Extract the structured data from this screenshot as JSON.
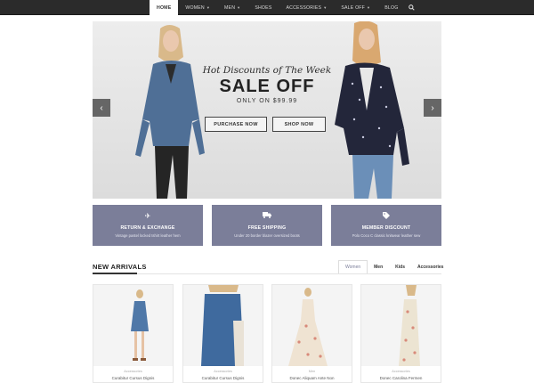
{
  "nav": {
    "items": [
      {
        "label": "HOME",
        "active": true,
        "dropdown": false
      },
      {
        "label": "WOMEN",
        "active": false,
        "dropdown": true
      },
      {
        "label": "MEN",
        "active": false,
        "dropdown": true
      },
      {
        "label": "SHOES",
        "active": false,
        "dropdown": false
      },
      {
        "label": "ACCESSORIES",
        "active": false,
        "dropdown": true
      },
      {
        "label": "SALE OFF",
        "active": false,
        "dropdown": true
      },
      {
        "label": "BLOG",
        "active": false,
        "dropdown": false
      }
    ],
    "search_icon": "search-icon"
  },
  "hero": {
    "tagline": "Hot Discounts of The Week",
    "title": "SALE OFF",
    "subtitle": "ONLY ON $99.99",
    "primary_button": "PURCHASE NOW",
    "secondary_button": "SHOP NOW",
    "prev_icon": "chevron-left-icon",
    "next_icon": "chevron-right-icon"
  },
  "features": [
    {
      "icon": "paper-plane-icon",
      "title": "RETURN & EXCHANGE",
      "description": "Vintage pastel locked tshirt leather hem"
    },
    {
      "icon": "truck-icon",
      "title": "FREE SHIPPING",
      "description": "Under 20 border blazer oversized boots"
    },
    {
      "icon": "tag-icon",
      "title": "MEMBER DISCOUNT",
      "description": "Polo Coco C classic knitwear leather sew"
    }
  ],
  "new_arrivals": {
    "title": "NEW ARRIVALS",
    "tabs": [
      {
        "label": "Women",
        "active": true
      },
      {
        "label": "Men",
        "active": false
      },
      {
        "label": "Kids",
        "active": false
      },
      {
        "label": "Accessories",
        "active": false
      }
    ],
    "products": [
      {
        "category": "Accessories",
        "name": "Curabitur Cursus Dignis"
      },
      {
        "category": "Accessories",
        "name": "Curabitur Cursus Dignis"
      },
      {
        "category": "Men",
        "name": "Donec Aliquam Ante Non"
      },
      {
        "category": "Accessories",
        "name": "Donec Carolina Fermen"
      }
    ]
  },
  "colors": {
    "topbar": "#2b2b2b",
    "feature_box": "#7b7e99",
    "accent": "#7b7e99"
  }
}
